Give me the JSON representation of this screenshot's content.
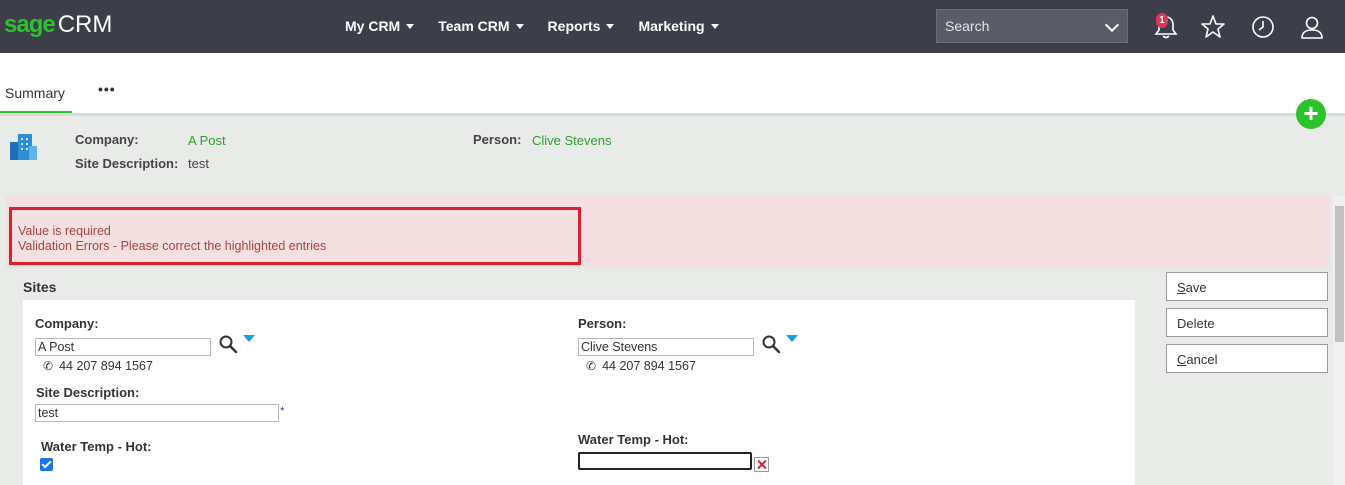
{
  "app": {
    "brand_sage": "sage",
    "brand_crm": "CRM"
  },
  "nav": {
    "items": [
      {
        "label": "My CRM"
      },
      {
        "label": "Team CRM"
      },
      {
        "label": "Reports"
      },
      {
        "label": "Marketing"
      }
    ]
  },
  "search": {
    "placeholder": "Search"
  },
  "notifications": {
    "count": "1"
  },
  "tabs": {
    "summary": "Summary",
    "more": "•••"
  },
  "summary": {
    "company_label": "Company:",
    "company_value": "A Post",
    "site_label": "Site Description:",
    "site_value": "test",
    "person_label": "Person:",
    "person_value": "Clive Stevens"
  },
  "errors": {
    "line1": "Value is required",
    "line2": "Validation Errors - Please correct the highlighted entries"
  },
  "form": {
    "section_title": "Sites",
    "company_label": "Company:",
    "company_value": "A Post",
    "company_phone": "44 207 894 1567",
    "person_label": "Person:",
    "person_value": "Clive Stevens",
    "person_phone": "44 207 894 1567",
    "site_label": "Site Description:",
    "site_value": "test",
    "required_mark": "*",
    "water_hot_label_left": "Water Temp - Hot:",
    "water_hot_checked": true,
    "water_hot_label_right": "Water Temp - Hot:",
    "water_hot_value_right": ""
  },
  "actions": {
    "save_first": "S",
    "save_rest": "ave",
    "delete": "Delete",
    "cancel_first": "C",
    "cancel_rest": "ancel"
  },
  "colors": {
    "brand_green": "#2cc22c",
    "error_red": "#d9202c",
    "link_green": "#2ba02b",
    "topbar": "#3c3f4a"
  }
}
